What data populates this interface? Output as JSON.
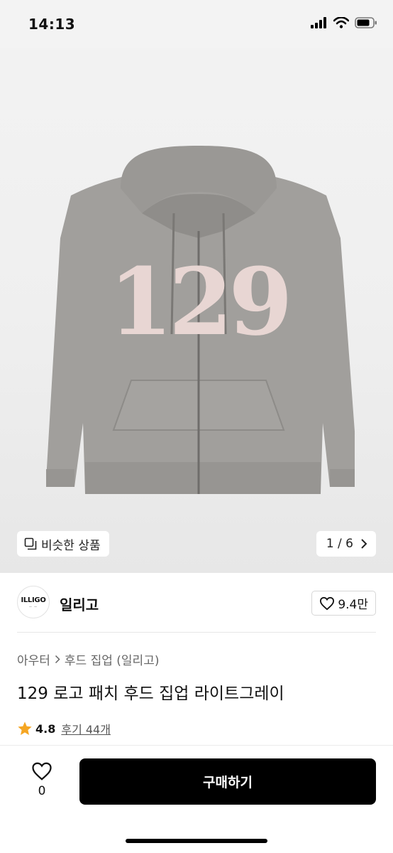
{
  "status_bar": {
    "time": "14:13"
  },
  "image_area": {
    "similar_label": "비슷한 상품",
    "page_indicator": "1 / 6",
    "patch_text": "129"
  },
  "brand": {
    "logo_text": "ILLIGO",
    "name": "일리고",
    "like_count": "9.4만"
  },
  "breadcrumb": {
    "category": "아우터",
    "subcategory": "후드 집업 (일리고)"
  },
  "product": {
    "title": "129 로고 패치 후드 집업 라이트그레이",
    "rating": "4.8",
    "reviews": "후기 44개"
  },
  "bottom_bar": {
    "wish_count": "0",
    "buy_label": "구매하기"
  },
  "colors": {
    "hoodie": "#9e9e9c",
    "patch": "#e8d6d3",
    "star": "#f5a623",
    "buy_button": "#000000"
  },
  "icons": [
    "cellular-signal-icon",
    "wifi-icon",
    "battery-icon",
    "copy-icon",
    "chevron-right-icon",
    "heart-icon",
    "star-icon"
  ]
}
